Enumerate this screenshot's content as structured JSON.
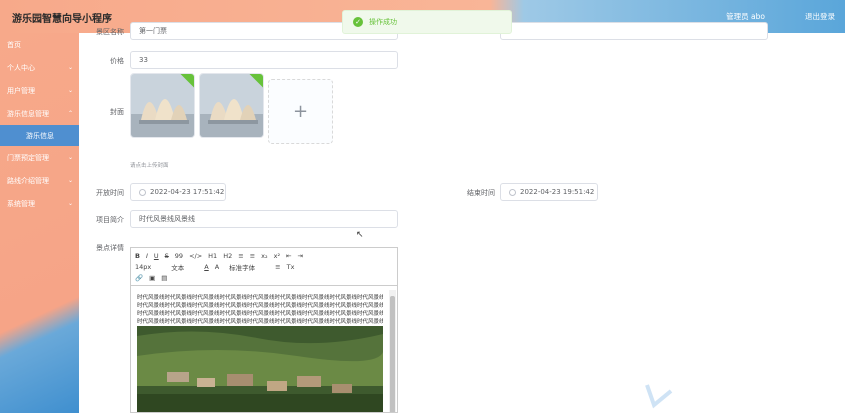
{
  "header": {
    "app_title": "游乐园智慧向导小程序",
    "user_label": "管理员 abo",
    "logout_label": "退出登录"
  },
  "toast": {
    "message": "操作成功"
  },
  "sidebar": {
    "items": [
      {
        "label": "首页"
      },
      {
        "label": "个人中心"
      },
      {
        "label": "用户管理"
      },
      {
        "label": "游乐信息管理"
      },
      {
        "label": "游乐信息"
      },
      {
        "label": "门票预定管理"
      },
      {
        "label": "路线介绍管理"
      },
      {
        "label": "系统管理"
      }
    ]
  },
  "form": {
    "name_label": "景区名称",
    "name_value": "第一门票",
    "price_label": "价格",
    "price_value": "33",
    "cover_label": "封面",
    "upload_hint": "请点击上传封面",
    "open_time_label": "开放时间",
    "open_time_value": "2022-04-23 17:51:42",
    "close_time_label": "结束时间",
    "close_time_value": "2022-04-23 19:51:42",
    "summary_label": "项目简介",
    "summary_value": "时代风景线风景线",
    "detail_label": "景点详情"
  },
  "editor": {
    "toolbar_row1": [
      "B",
      "I",
      "U",
      "S",
      "99",
      "</>",
      "H1",
      "H2",
      "≡",
      "≡",
      "x₂",
      "x²",
      "⇤",
      "⇥"
    ],
    "toolbar_row2": [
      "14px",
      "文本",
      "A",
      "A",
      "标准字体",
      "≡",
      "Tx"
    ],
    "toolbar_row3": [
      "🔗",
      "▣",
      "▤"
    ],
    "text_lines": [
      "时代风景线时代风景线时代风景线时代风景线时代风景线时代风景线时代风景线时代风景线时代风景线",
      "时代风景线时代风景线时代风景线时代风景线时代风景线时代风景线时代风景线时代风景线时代风景线",
      "时代风景线时代风景线时代风景线时代风景线时代风景线时代风景线时代风景线时代风景线时代风景线",
      "时代风景线时代风景线时代风景线时代风景线时代风景线时代风景线时代风景线时代风景线时代风景线"
    ]
  },
  "colors": {
    "header_orange": "#f7a98a",
    "header_blue": "#5aa6da",
    "success_green": "#67c23a"
  }
}
